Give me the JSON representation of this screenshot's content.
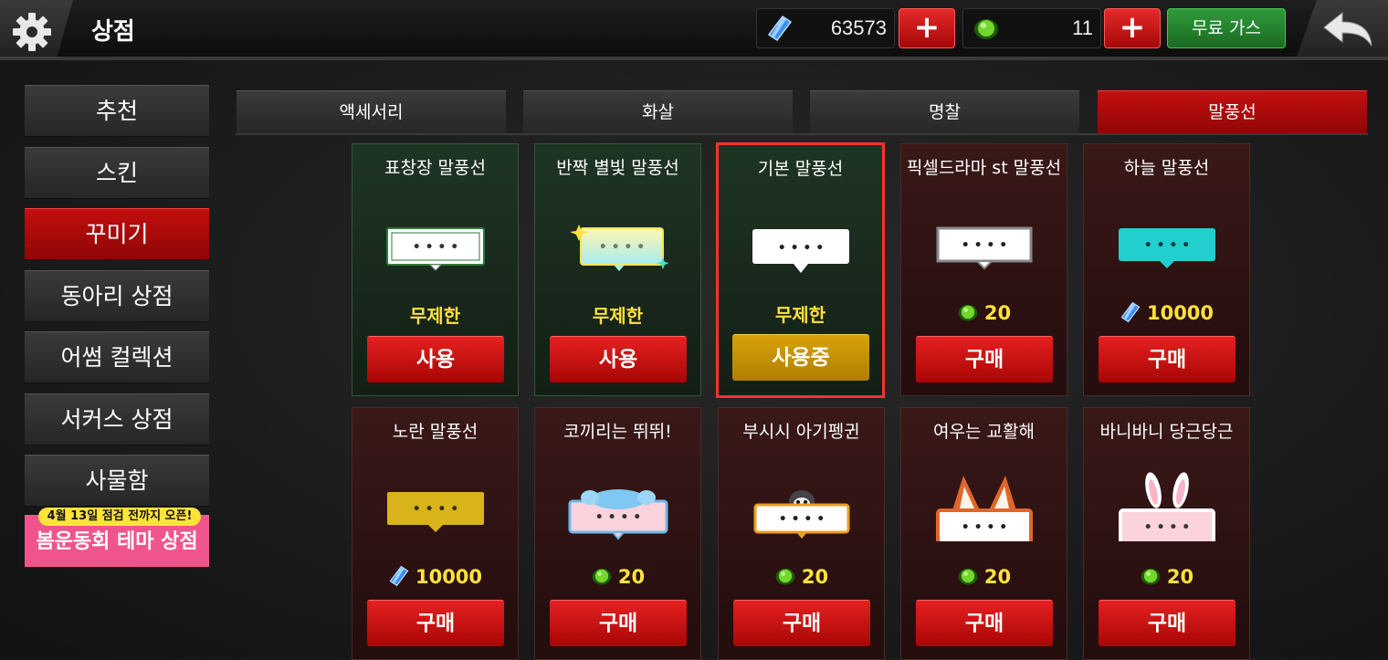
{
  "header": {
    "title": "상점",
    "gems": "63573",
    "gas": "11",
    "free_gas_label": "무료 가스"
  },
  "menu": [
    {
      "label": "추천",
      "active": false
    },
    {
      "label": "스킨",
      "active": false
    },
    {
      "label": "꾸미기",
      "active": true
    },
    {
      "label": "동아리 상점",
      "active": false
    },
    {
      "label": "어썸 컬렉션",
      "active": false
    },
    {
      "label": "서커스 상점",
      "active": false
    },
    {
      "label": "사물함",
      "active": false
    }
  ],
  "event": {
    "badge": "4월 13일 점검 전까지 오픈!",
    "label": "봄운동회 테마 상점"
  },
  "tabs": [
    {
      "label": "액세서리",
      "active": false
    },
    {
      "label": "화살",
      "active": false
    },
    {
      "label": "명찰",
      "active": false
    },
    {
      "label": "말풍선",
      "active": true
    }
  ],
  "items": [
    {
      "name": "표창장 말풍선",
      "status": "무제한",
      "action": "사용",
      "state": "owned",
      "bubble": "certificate"
    },
    {
      "name": "반짝 별빛 말풍선",
      "status": "무제한",
      "action": "사용",
      "state": "owned",
      "bubble": "sparkle"
    },
    {
      "name": "기본 말풍선",
      "status": "무제한",
      "action": "사용중",
      "state": "selected",
      "bubble": "basic"
    },
    {
      "name": "픽셀드라마 st 말풍선",
      "price": "20",
      "currency": "gas",
      "action": "구매",
      "state": "buy",
      "bubble": "pixel"
    },
    {
      "name": "하늘 말풍선",
      "price": "10000",
      "currency": "gem",
      "action": "구매",
      "state": "buy",
      "bubble": "sky"
    },
    {
      "name": "노란 말풍선",
      "price": "10000",
      "currency": "gem",
      "action": "구매",
      "state": "buy",
      "bubble": "yellow"
    },
    {
      "name": "코끼리는 뛰뛰!",
      "price": "20",
      "currency": "gas",
      "action": "구매",
      "state": "buy",
      "bubble": "elephant"
    },
    {
      "name": "부시시 아기펭귄",
      "price": "20",
      "currency": "gas",
      "action": "구매",
      "state": "buy",
      "bubble": "penguin"
    },
    {
      "name": "여우는 교활해",
      "price": "20",
      "currency": "gas",
      "action": "구매",
      "state": "buy",
      "bubble": "fox"
    },
    {
      "name": "바니바니 당근당근",
      "price": "20",
      "currency": "gas",
      "action": "구매",
      "state": "buy",
      "bubble": "bunny"
    }
  ],
  "bubble_text": "····",
  "colors": {
    "active_red": "#c40f0f",
    "price_yellow": "#ffe23a",
    "in_use_gold": "#d9a20a",
    "event_pink": "#f0548c",
    "free_gas_green": "#2f9a3a"
  }
}
